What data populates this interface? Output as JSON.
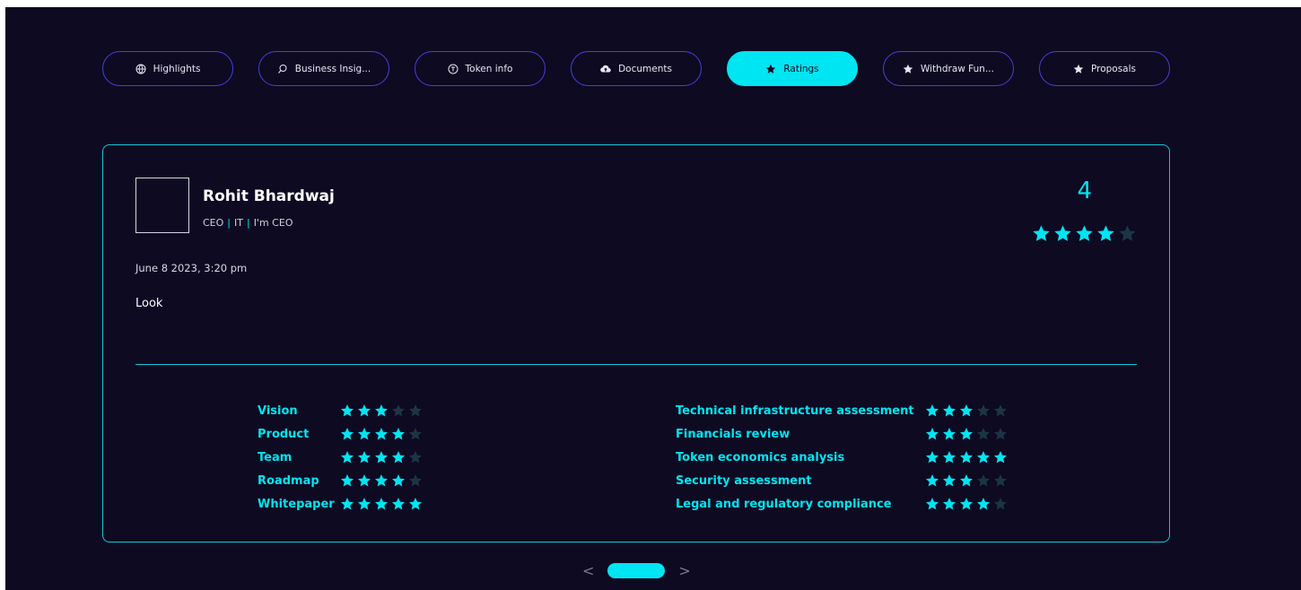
{
  "tabs": [
    {
      "label": "Highlights",
      "icon": "globe-icon"
    },
    {
      "label": "Business Insig...",
      "icon": "magnifier-icon"
    },
    {
      "label": "Token info",
      "icon": "token-icon"
    },
    {
      "label": "Documents",
      "icon": "cloud-upload-icon"
    },
    {
      "label": "Ratings",
      "icon": "star-icon",
      "active": true
    },
    {
      "label": "Withdraw Fun...",
      "icon": "star-icon"
    },
    {
      "label": "Proposals",
      "icon": "star-icon"
    }
  ],
  "review": {
    "name": "Rohit Bhardwaj",
    "role": "CEO",
    "sector": "IT",
    "bio": "I'm CEO",
    "date": "June 8 2023, 3:20 pm",
    "text": "Look",
    "overall_score": "4",
    "overall_stars": 4
  },
  "criteria_left": [
    {
      "label": "Vision",
      "stars": 3
    },
    {
      "label": "Product",
      "stars": 4
    },
    {
      "label": "Team",
      "stars": 4
    },
    {
      "label": "Roadmap",
      "stars": 4
    },
    {
      "label": "Whitepaper",
      "stars": 5
    }
  ],
  "criteria_right": [
    {
      "label": "Technical infrastructure assessment",
      "stars": 3
    },
    {
      "label": "Financials review",
      "stars": 3
    },
    {
      "label": "Token economics analysis",
      "stars": 5
    },
    {
      "label": "Security assessment",
      "stars": 3
    },
    {
      "label": "Legal and regulatory compliance",
      "stars": 4
    }
  ],
  "pager": {
    "prev": "<",
    "next": ">"
  },
  "colors": {
    "accent": "#00e5f2",
    "background": "#0d0a22",
    "tab_border": "#4b3fd8",
    "star_off": "#1c3546"
  }
}
